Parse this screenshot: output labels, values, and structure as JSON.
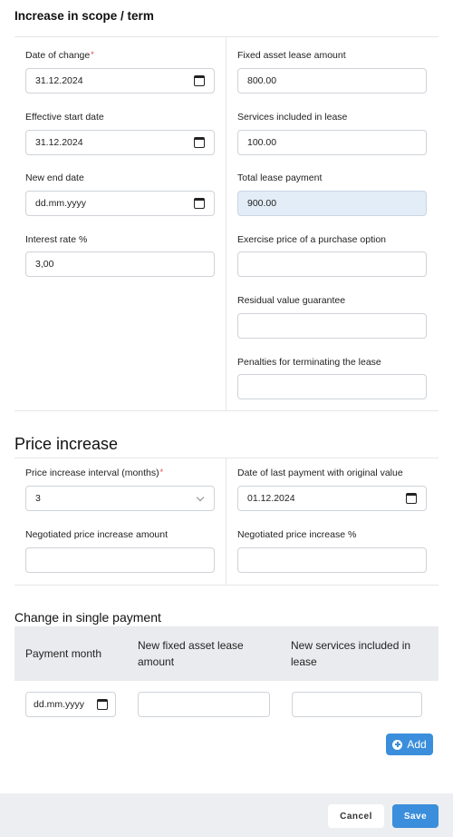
{
  "section_scope": {
    "title": "Increase in scope / term",
    "left": {
      "date_of_change": {
        "label": "Date of change",
        "value": "31.12.2024"
      },
      "effective_start": {
        "label": "Effective start date",
        "value": "31.12.2024"
      },
      "new_end": {
        "label": "New end date",
        "placeholder": "dd.mm.yyyy"
      },
      "interest": {
        "label": "Interest rate %",
        "value": "3,00"
      }
    },
    "right": {
      "fixed_asset": {
        "label": "Fixed asset lease amount",
        "value": "800.00"
      },
      "services": {
        "label": "Services included in lease",
        "value": "100.00"
      },
      "total": {
        "label": "Total lease payment",
        "value": "900.00"
      },
      "exercise": {
        "label": "Exercise price of a purchase option",
        "value": ""
      },
      "residual": {
        "label": "Residual value guarantee",
        "value": ""
      },
      "penalties": {
        "label": "Penalties for terminating the lease",
        "value": ""
      }
    }
  },
  "section_price": {
    "title": "Price increase",
    "interval": {
      "label": "Price increase interval (months)",
      "value": "3"
    },
    "last_payment": {
      "label": "Date of last payment with original value",
      "value": "01.12.2024"
    },
    "neg_amount": {
      "label": "Negotiated price increase amount",
      "value": ""
    },
    "neg_percent": {
      "label": "Negotiated price increase %",
      "value": ""
    }
  },
  "section_single": {
    "title": "Change in single payment",
    "columns": [
      "Payment month",
      "New fixed asset lease amount",
      "New services included in lease"
    ],
    "row": {
      "month_placeholder": "dd.mm.yyyy",
      "fixed": "",
      "services": ""
    },
    "add_label": "Add"
  },
  "footer": {
    "cancel": "Cancel",
    "save": "Save"
  },
  "colors": {
    "accent": "#3b8edb",
    "required": "#e0454a",
    "readonly_bg": "#e3edf7"
  },
  "icons": [
    "calendar-icon",
    "chevron-down-icon",
    "plus-circle-icon"
  ]
}
